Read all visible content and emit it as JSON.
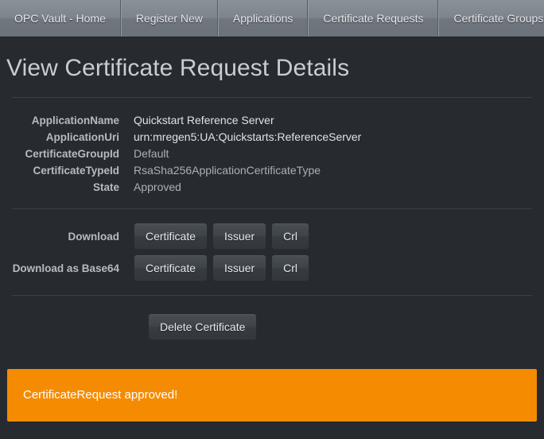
{
  "navbar": {
    "items": [
      {
        "label": "OPC Vault - Home"
      },
      {
        "label": "Register New"
      },
      {
        "label": "Applications"
      },
      {
        "label": "Certificate Requests"
      },
      {
        "label": "Certificate Groups"
      }
    ]
  },
  "page": {
    "title": "View Certificate Request Details"
  },
  "details": [
    {
      "label": "ApplicationName",
      "value": "Quickstart Reference Server"
    },
    {
      "label": "ApplicationUri",
      "value": "urn:mregen5:UA:Quickstarts:ReferenceServer"
    },
    {
      "label": "CertificateGroupId",
      "value": "Default"
    },
    {
      "label": "CertificateTypeId",
      "value": "RsaSha256ApplicationCertificateType"
    },
    {
      "label": "State",
      "value": "Approved"
    }
  ],
  "downloads": {
    "rows": [
      {
        "label": "Download",
        "buttons": [
          {
            "label": "Certificate"
          },
          {
            "label": "Issuer"
          },
          {
            "label": "Crl"
          }
        ]
      },
      {
        "label": "Download as Base64",
        "buttons": [
          {
            "label": "Certificate"
          },
          {
            "label": "Issuer"
          },
          {
            "label": "Crl"
          }
        ]
      }
    ]
  },
  "actions": {
    "delete_label": "Delete Certificate"
  },
  "alert": {
    "message": "CertificateRequest approved!",
    "background_color": "#f58b00",
    "text_color": "#ffffff"
  },
  "colors": {
    "page_background": "#272b30",
    "navbar_background": "#7d848c",
    "divider": "#3a3f44",
    "button_background": "#3e4449",
    "title_text": "#c8cdd2"
  }
}
